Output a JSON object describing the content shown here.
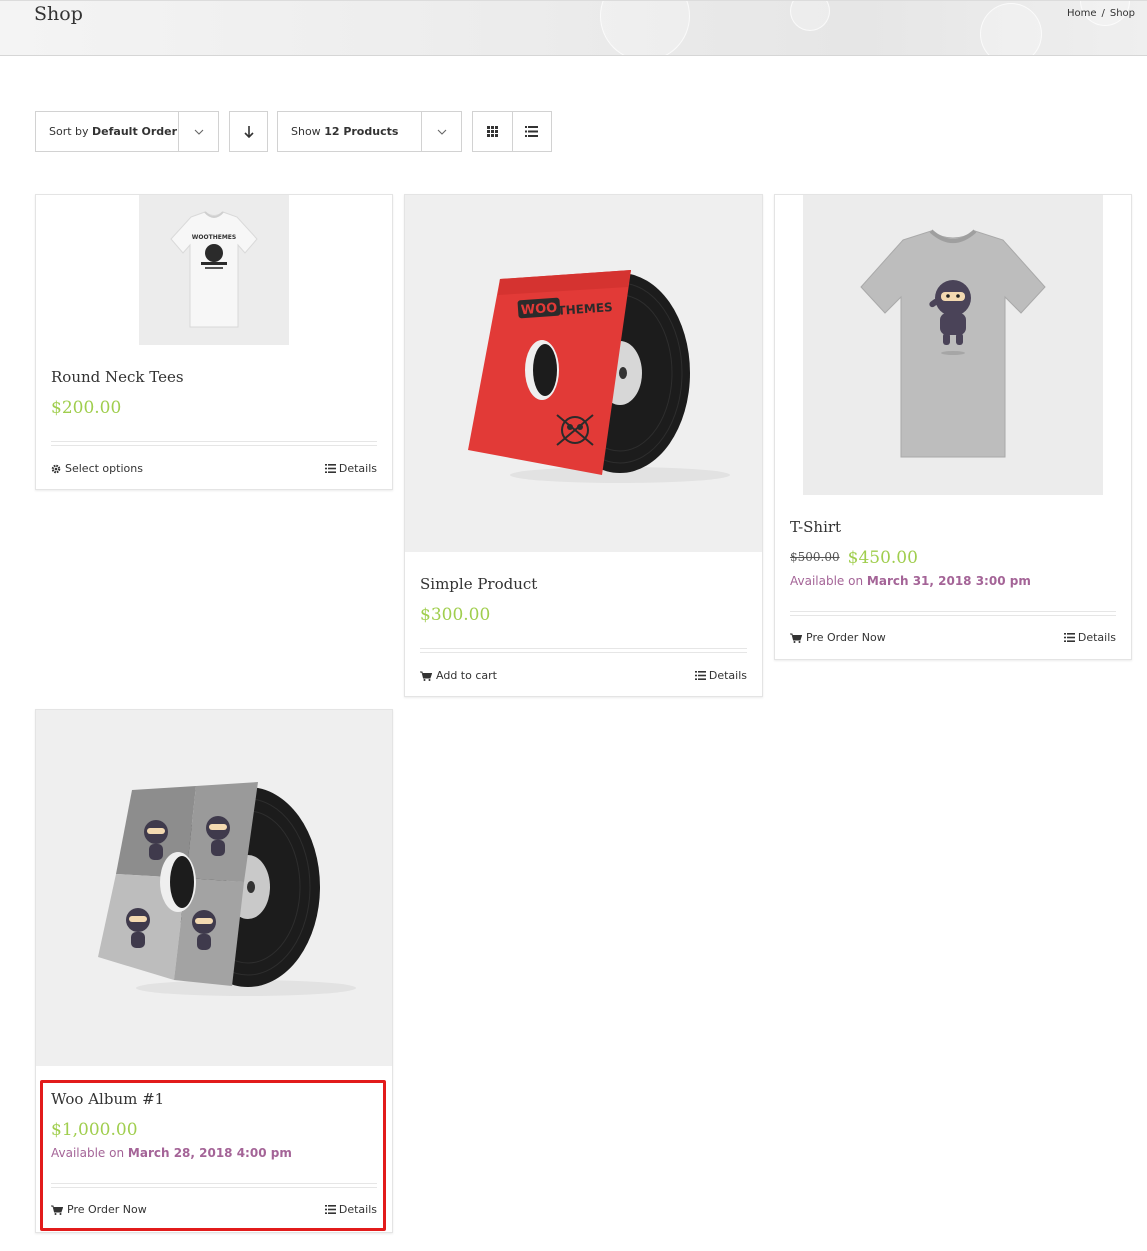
{
  "header": {
    "title": "Shop",
    "breadcrumb": [
      "Home",
      "Shop"
    ],
    "breadcrumb_separator": "/"
  },
  "toolbar": {
    "sort_prefix": "Sort by",
    "sort_value": "Default Order",
    "show_prefix": "Show",
    "show_value": "12 Products",
    "direction_icon": "arrow-down-icon",
    "grid_icon": "grid-view-icon",
    "list_icon": "list-view-icon"
  },
  "products": [
    {
      "title": "Round Neck Tees",
      "price": "$200.00",
      "action_label": "Select options",
      "action_icon": "gear-icon",
      "details_label": "Details",
      "image": "white-tshirt-woothemes"
    },
    {
      "title": "Simple Product",
      "price": "$300.00",
      "action_label": "Add to cart",
      "action_icon": "cart-icon",
      "details_label": "Details",
      "image": "red-vinyl-woothemes"
    },
    {
      "title": "T-Shirt",
      "regular_price": "$500.00",
      "price": "$450.00",
      "available_prefix": "Available on",
      "available_date": "March 31, 2018 3:00 pm",
      "action_label": "Pre Order Now",
      "action_icon": "cart-icon",
      "details_label": "Details",
      "image": "grey-tshirt-ninja"
    },
    {
      "title": "Woo Album #1",
      "price": "$1,000.00",
      "available_prefix": "Available on",
      "available_date": "March 28, 2018 4:00 pm",
      "action_label": "Pre Order Now",
      "action_icon": "cart-icon",
      "details_label": "Details",
      "image": "grey-vinyl-ninjas"
    }
  ],
  "colors": {
    "price": "#a0ce4e",
    "availability": "#a46497",
    "highlight": "#e21b1b"
  }
}
